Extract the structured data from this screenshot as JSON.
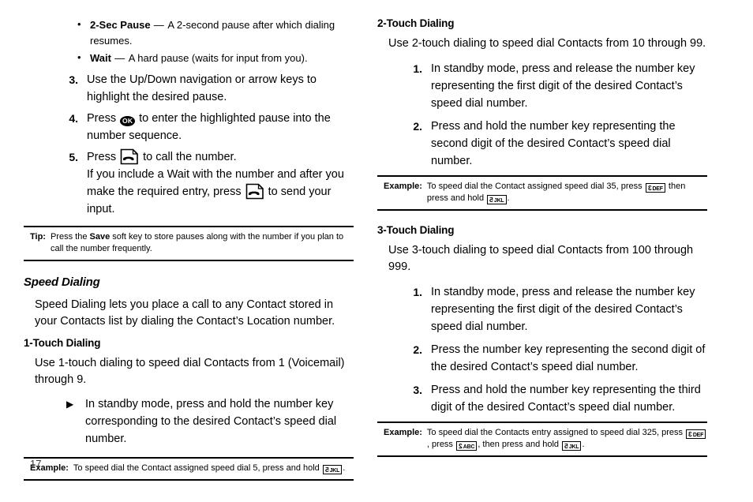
{
  "page": {
    "number": "17"
  },
  "left_column": {
    "pause_bullets": [
      {
        "marker": "•",
        "term": "2-Sec Pause",
        "dash": " — ",
        "definition": "A 2-second pause after which dialing resumes."
      },
      {
        "marker": "•",
        "term": "Wait",
        "dash": " — ",
        "definition": "A hard pause (waits for input from you)."
      }
    ],
    "steps": [
      {
        "marker": "3.",
        "text": "Use the Up/Down navigation or arrow keys to highlight the desired pause."
      },
      {
        "marker": "4.",
        "pre": "Press ",
        "icon": "ok-key-icon",
        "post": " to enter the highlighted pause into the number sequence."
      },
      {
        "marker": "5.",
        "pre": "Press ",
        "icon": "send-key-icon",
        "post": " to call the number.",
        "continuation_pre": "If you include a Wait with the number and after you make the required entry, press ",
        "continuation_icon": "send-key-icon",
        "continuation_post": " to send your input."
      }
    ],
    "tip": {
      "label": "Tip:",
      "text_before_bold": "Press the ",
      "bold": "Save",
      "text_after_bold": " soft key to store pauses along with the number if you plan to call the number frequently."
    },
    "speed_dialing": {
      "title": "Speed Dialing",
      "intro": "Speed Dialing lets you place a call to any Contact stored in your Contacts list by dialing the Contact’s Location number."
    },
    "one_touch": {
      "title": "1-Touch Dialing",
      "intro": "Use 1-touch dialing to speed dial Contacts from 1 (Voicemail) through 9.",
      "bullet_marker": "▶",
      "bullet_text": "In standby mode, press and hold the number key corresponding to the desired Contact’s speed dial number.",
      "example": {
        "label": "Example:",
        "text_before": "To speed dial the Contact assigned speed dial 5, press and hold ",
        "key": {
          "digit": "5",
          "letters": "JKL"
        },
        "text_after": "."
      }
    }
  },
  "right_column": {
    "two_touch": {
      "title": "2-Touch Dialing",
      "intro": "Use 2-touch dialing to speed dial Contacts from 10 through 99.",
      "steps": [
        {
          "marker": "1.",
          "text": "In standby mode, press and release the number key representing the first digit of the desired Contact’s speed dial number."
        },
        {
          "marker": "2.",
          "text": "Press and hold the number key representing the second digit of the desired Contact’s speed dial number."
        }
      ],
      "example": {
        "label": "Example:",
        "part1": "To speed dial the Contact assigned speed dial 35, press ",
        "key1": {
          "digit": "3",
          "letters": "DEF"
        },
        "part2": " then press and hold ",
        "key2": {
          "digit": "5",
          "letters": "JKL"
        },
        "part3": "."
      }
    },
    "three_touch": {
      "title": "3-Touch Dialing",
      "intro": "Use 3-touch dialing to speed dial Contacts from 100 through 999.",
      "steps": [
        {
          "marker": "1.",
          "text": "In standby mode, press and release the number key representing the first digit of the desired Contact’s speed dial number."
        },
        {
          "marker": "2.",
          "text": "Press the number key representing the second digit of the desired Contact’s speed dial number."
        },
        {
          "marker": "3.",
          "text": "Press and hold the number key representing the third digit of the desired Contact’s speed dial number."
        }
      ],
      "example": {
        "label": "Example:",
        "part1": "To speed dial the Contacts entry assigned to speed dial 325, press ",
        "key1": {
          "digit": "3",
          "letters": "DEF"
        },
        "part2": ", press ",
        "key2": {
          "digit": "2",
          "letters": "ABC"
        },
        "part3": ", then press and hold ",
        "key3": {
          "digit": "5",
          "letters": "JKL"
        },
        "part4": "."
      }
    }
  },
  "icons": {
    "ok_key_label": "OK"
  }
}
